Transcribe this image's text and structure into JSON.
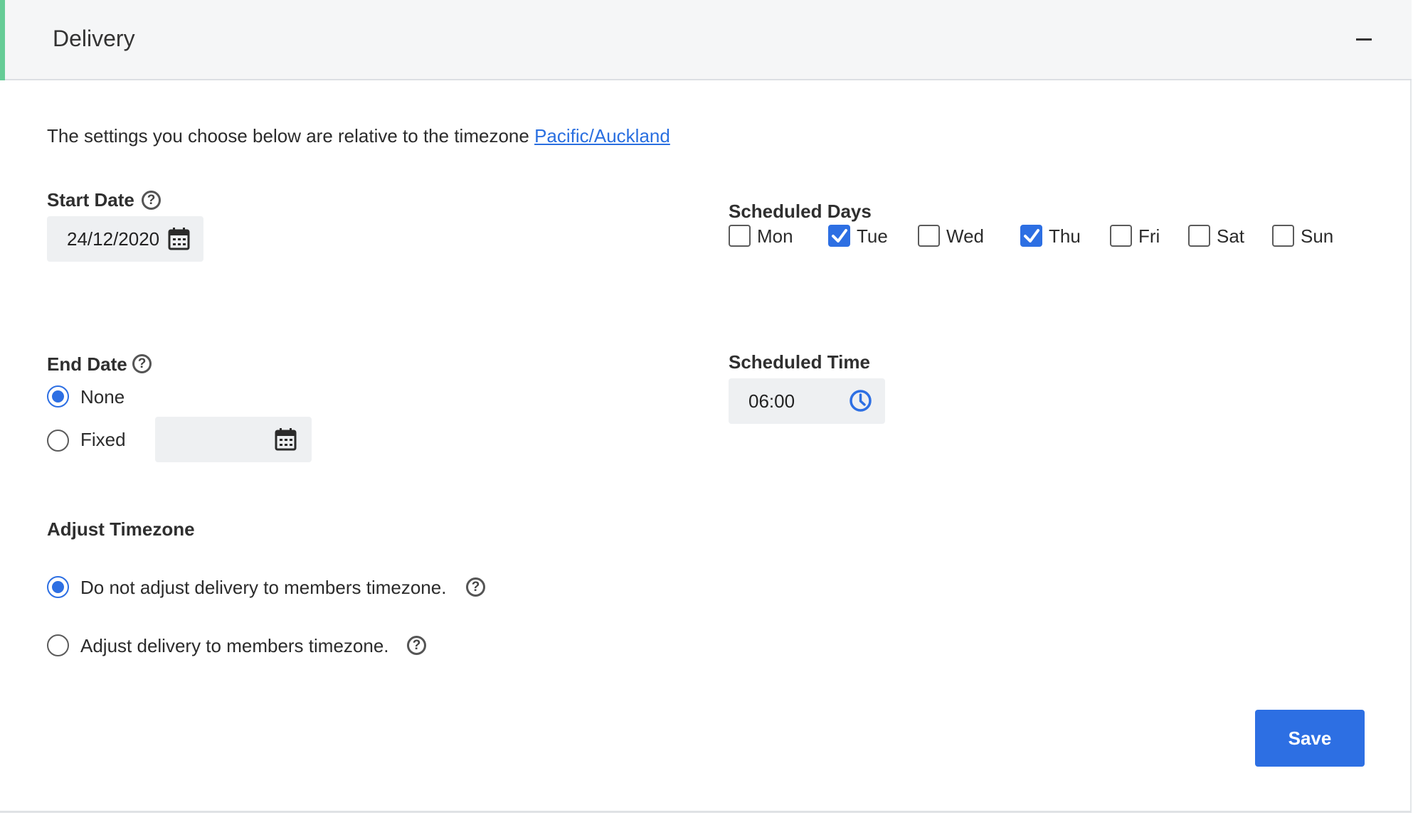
{
  "header": {
    "title": "Delivery"
  },
  "intro": {
    "text": "The settings you choose below are relative to the timezone ",
    "timezone_link": "Pacific/Auckland"
  },
  "start_date": {
    "label": "Start Date",
    "value": "24/12/2020"
  },
  "end_date": {
    "label": "End Date",
    "options": [
      {
        "label": "None",
        "selected": true
      },
      {
        "label": "Fixed",
        "selected": false
      }
    ],
    "fixed_value": ""
  },
  "scheduled_days": {
    "label": "Scheduled Days",
    "days": [
      {
        "label": "Mon",
        "checked": false
      },
      {
        "label": "Tue",
        "checked": true
      },
      {
        "label": "Wed",
        "checked": false
      },
      {
        "label": "Thu",
        "checked": true
      },
      {
        "label": "Fri",
        "checked": false
      },
      {
        "label": "Sat",
        "checked": false
      },
      {
        "label": "Sun",
        "checked": false
      }
    ]
  },
  "scheduled_time": {
    "label": "Scheduled Time",
    "value": "06:00"
  },
  "adjust_timezone": {
    "label": "Adjust Timezone",
    "options": [
      {
        "label": "Do not adjust delivery to members timezone.",
        "selected": true
      },
      {
        "label": "Adjust delivery to members timezone.",
        "selected": false
      }
    ]
  },
  "actions": {
    "save_label": "Save"
  },
  "icons": {
    "calendar": "calendar-icon",
    "clock": "clock-icon",
    "help": "help-icon",
    "collapse": "minus-icon"
  },
  "colors": {
    "accent": "#2d6fe3",
    "header_stripe": "#66cc96",
    "link": "#2a6fe0"
  }
}
